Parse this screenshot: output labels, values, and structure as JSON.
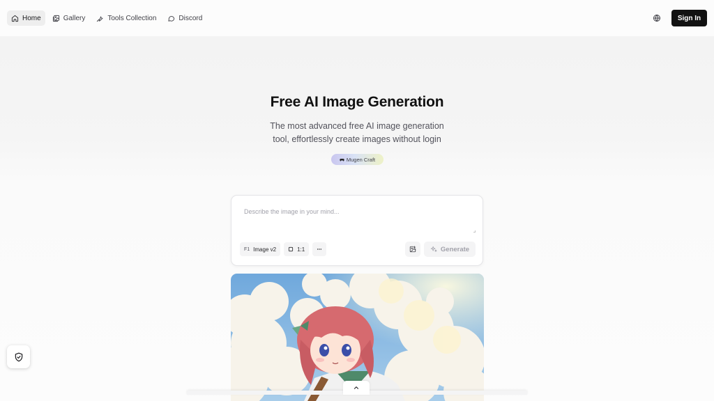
{
  "nav": {
    "items": [
      {
        "label": "Home",
        "icon": "home-icon",
        "active": true
      },
      {
        "label": "Gallery",
        "icon": "gallery-icon",
        "active": false
      },
      {
        "label": "Tools Collection",
        "icon": "tools-icon",
        "active": false
      },
      {
        "label": "Discord",
        "icon": "chat-bubble-icon",
        "active": false
      }
    ],
    "language_icon": "globe-icon",
    "signin_label": "Sign In"
  },
  "hero": {
    "title": "Free AI Image Generation",
    "subtitle_line1": "The most advanced free AI image generation",
    "subtitle_line2": "tool, effortlessly create images without login",
    "badge_label": "Mugen Craft",
    "badge_icon": "gamepad-icon"
  },
  "prompt": {
    "placeholder": "Describe the image in your mind...",
    "value": "",
    "model_prefix": "F1",
    "model_label": "Image v2",
    "aspect_label": "1:1",
    "more_icon": "more-horizontal-icon",
    "upload_icon": "image-upload-icon",
    "generate_label": "Generate",
    "generate_icon": "sparkles-icon"
  },
  "colors": {
    "primary_button": "#121212",
    "page_background": "#f5f5f5",
    "disabled_text": "#a1a1aa"
  },
  "floating": {
    "shield_icon": "shield-check-icon",
    "drawer_icon": "chevron-up-icon"
  }
}
